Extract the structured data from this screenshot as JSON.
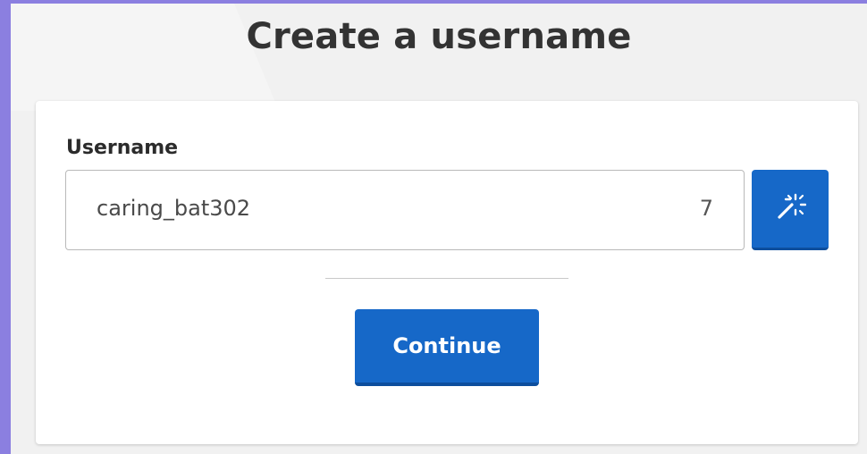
{
  "page": {
    "title": "Create a username"
  },
  "form": {
    "username_label": "Username",
    "username_value": "caring_bat302",
    "char_count": "7",
    "generate_icon": "magic-wand-icon",
    "continue_label": "Continue"
  },
  "colors": {
    "background": "#8b7fe0",
    "page": "#f1f1f1",
    "accent": "#1668c8",
    "text": "#333333"
  }
}
